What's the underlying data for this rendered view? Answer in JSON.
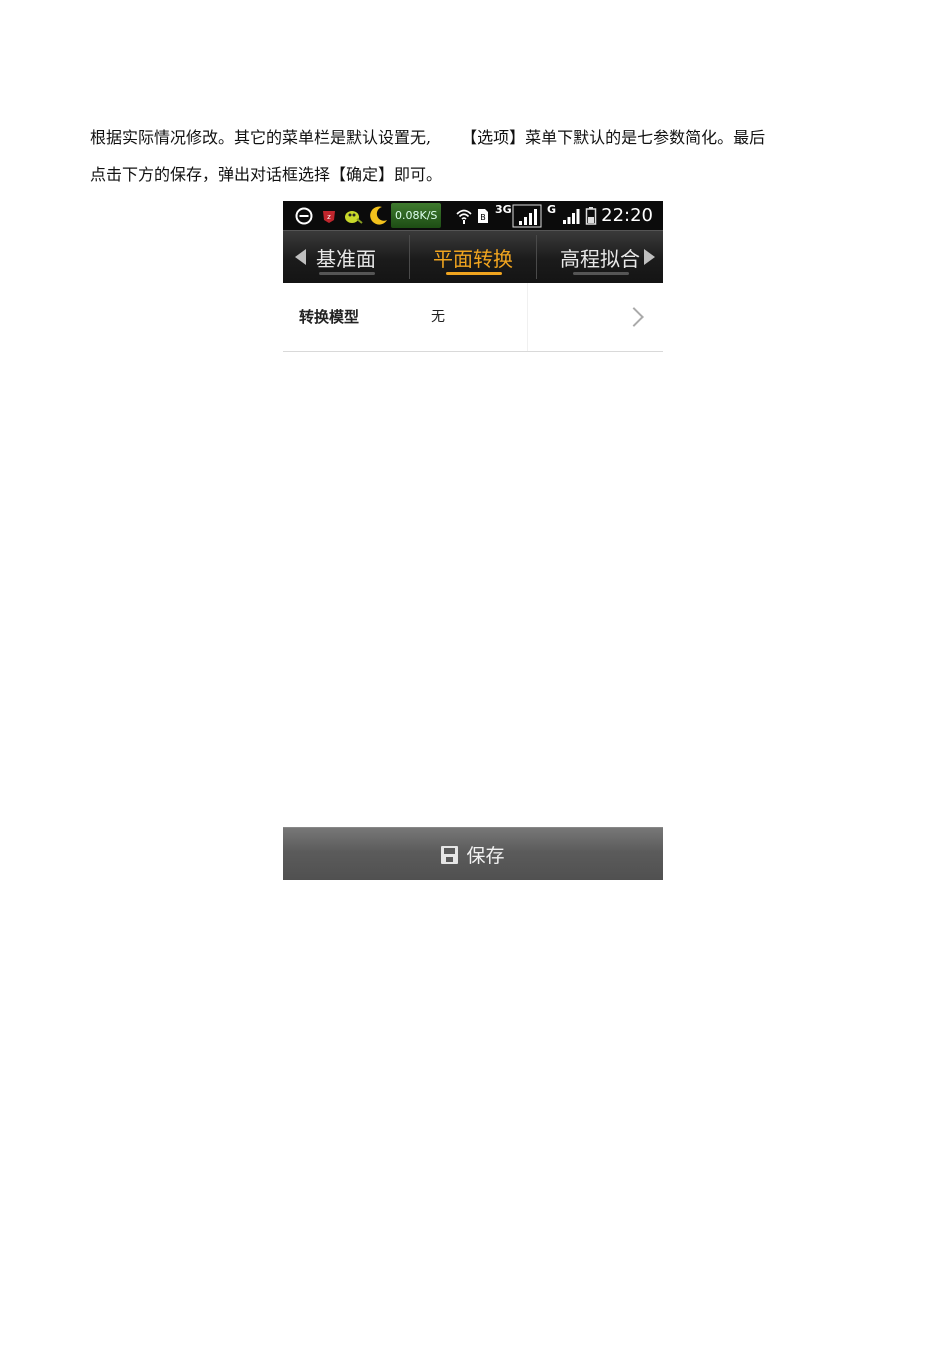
{
  "document": {
    "line1_part1": "根据实际情况修改。其它的菜单栏是默认设置无,",
    "line1_part2": "【选项】菜单下默认的是七参数简化。最后",
    "line2": "点击下方的保存，弹出对话框选择【确定】即可。"
  },
  "statusbar": {
    "net_speed": "0.08K/S",
    "network_3g": "3G",
    "network_g": "G",
    "time": "22:20",
    "icons": [
      "minus-circle-icon",
      "z-app-icon",
      "bug-app-icon",
      "moon-app-icon",
      "wifi-icon",
      "sim-icon",
      "signal-icon",
      "signal-icon",
      "battery-icon"
    ]
  },
  "tabs": [
    {
      "label": "基准面",
      "active": false
    },
    {
      "label": "平面转换",
      "active": true
    },
    {
      "label": "高程拟合",
      "active": false
    }
  ],
  "row": {
    "label": "转换模型",
    "value": "无"
  },
  "save_button": {
    "label": "保存",
    "icon": "floppy-disk-icon"
  },
  "colors": {
    "active_tab": "#f0a41f",
    "tab_bar": "#1b1b1b",
    "save_button": "#5b5b5b"
  }
}
